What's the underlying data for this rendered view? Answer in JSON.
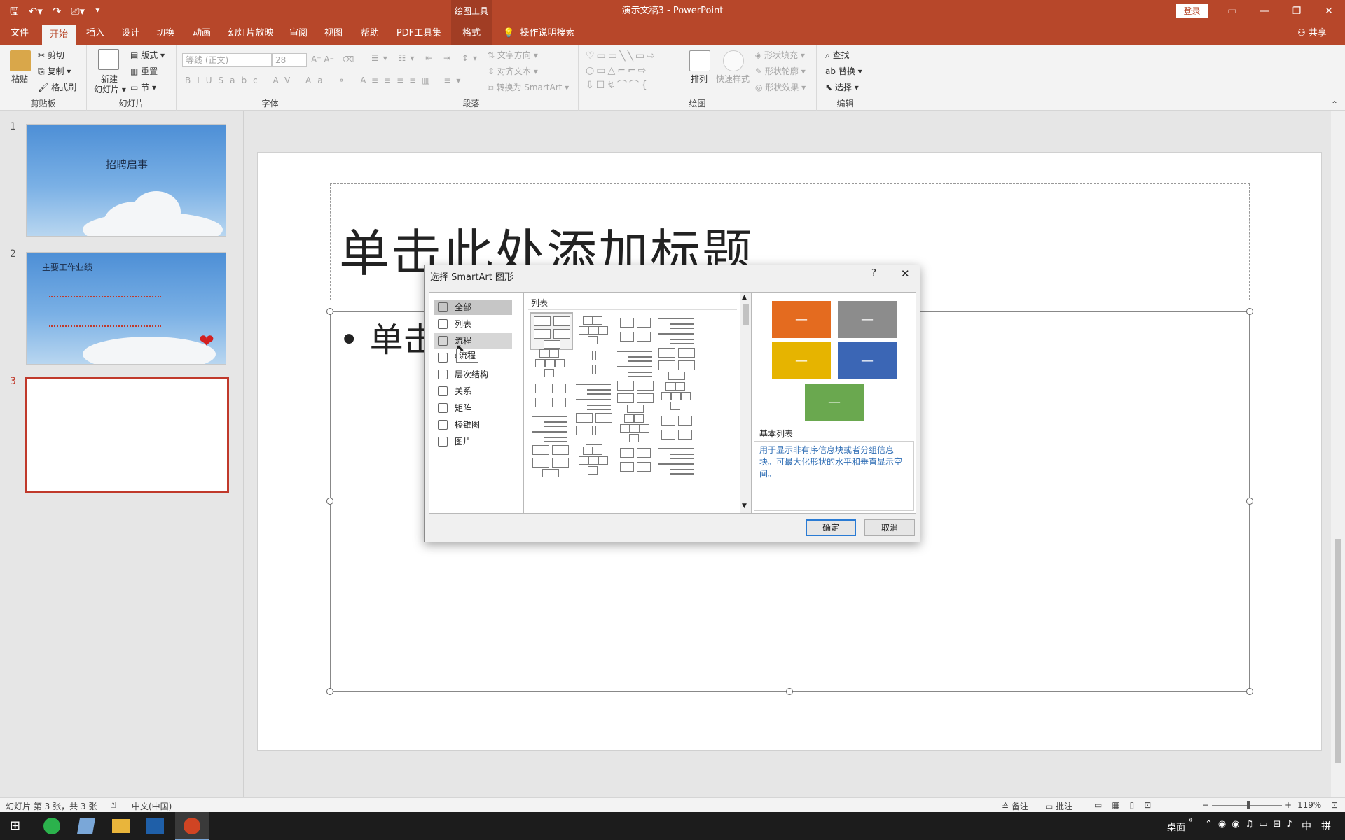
{
  "window": {
    "title": "演示文稿3  -  PowerPoint",
    "contextual_group": "绘图工具",
    "login": "登录",
    "minimize_icon": "minimize-icon",
    "restore_icon": "restore-icon",
    "close_icon": "close-icon"
  },
  "tabs": [
    "文件",
    "开始",
    "插入",
    "设计",
    "切换",
    "动画",
    "幻灯片放映",
    "审阅",
    "视图",
    "帮助",
    "PDF工具集",
    "格式"
  ],
  "search_tab": "操作说明搜索",
  "share": "共享",
  "ribbon": {
    "clipboard": {
      "label": "剪贴板",
      "paste": "粘贴",
      "cut": "剪切",
      "copy": "复制",
      "format_painter": "格式刷"
    },
    "slides": {
      "label": "幻灯片",
      "new_slide": "新建",
      "new_slide2": "幻灯片",
      "layout": "版式",
      "reset": "重置",
      "section": "节"
    },
    "font": {
      "label": "字体",
      "font_name": "等线 (正文)",
      "font_size": "28"
    },
    "paragraph": {
      "label": "段落",
      "text_direction": "文字方向",
      "align_text": "对齐文本",
      "convert_smartart": "转换为 SmartArt"
    },
    "drawing": {
      "label": "绘图",
      "arrange": "排列",
      "quick_styles": "快速样式",
      "shape_fill": "形状填充",
      "shape_outline": "形状轮廓",
      "shape_effects": "形状效果"
    },
    "editing": {
      "label": "编辑",
      "find": "查找",
      "replace": "替换",
      "select": "选择"
    }
  },
  "thumbnails": [
    {
      "num": "1",
      "title": "招聘启事"
    },
    {
      "num": "2",
      "title": "主要工作业绩"
    },
    {
      "num": "3",
      "title": ""
    }
  ],
  "slide": {
    "title_placeholder": "单击此处添加标题",
    "body_placeholder": "• 单击"
  },
  "dialog": {
    "title": "选择 SmartArt 图形",
    "help": "?",
    "categories": [
      "全部",
      "列表",
      "流程",
      "循环",
      "层次结构",
      "关系",
      "矩阵",
      "棱锥图",
      "图片"
    ],
    "selected_category": "全部",
    "hover_category": "流程",
    "tooltip": "流程",
    "layouts_header": "列表",
    "preview_name": "基本列表",
    "preview_desc": "用于显示非有序信息块或者分组信息块。可最大化形状的水平和垂直显示空间。",
    "preview_box_text": "—",
    "preview_colors": [
      "#e46b1f",
      "#8c8c8c",
      "#e6b400",
      "#3b66b5",
      "#6aa84f"
    ],
    "ok": "确定",
    "cancel": "取消"
  },
  "status": {
    "slide_info": "幻灯片 第 3 张，共 3 张",
    "language": "中文(中国)",
    "notes": "备注",
    "comments": "批注",
    "zoom": "119%"
  },
  "taskbar": {
    "desktop": "桌面",
    "ime": "中",
    "ime2": "拼"
  }
}
